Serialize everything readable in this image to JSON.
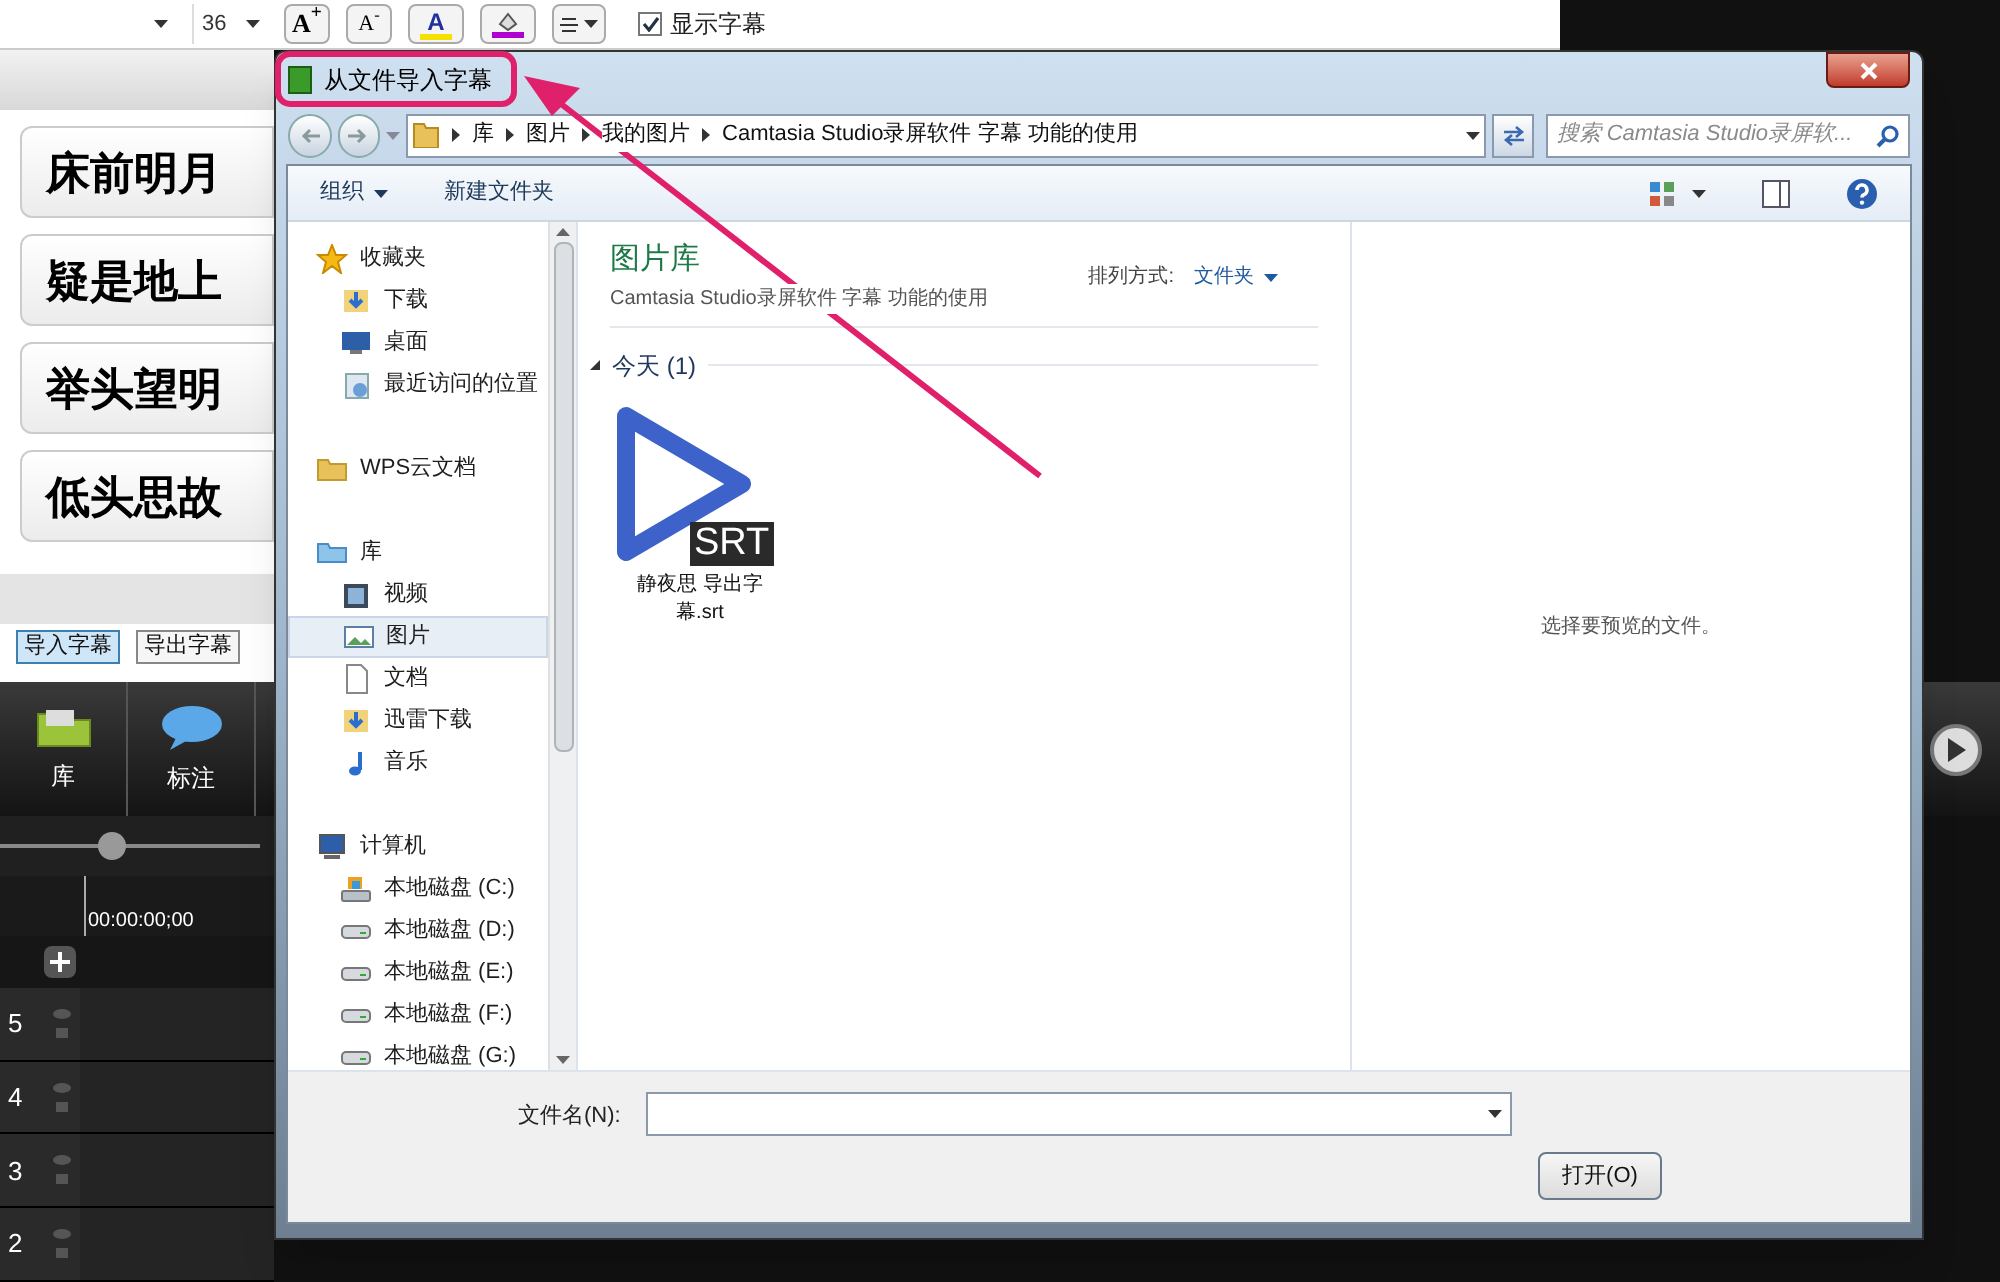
{
  "app": {
    "toolbar": {
      "font_size": "36",
      "grow_font": "A$^{+}$",
      "shrink_font": "A$^{-}$",
      "font_color": "A",
      "show_captions": {
        "label": "显示字幕",
        "checked": true
      }
    },
    "captions": [
      "床前明月",
      "疑是地上",
      "举头望明",
      "低头思故"
    ],
    "caption_buttons": [
      {
        "label": "导入字幕",
        "selected": true
      },
      {
        "label": "导出字幕",
        "selected": false
      }
    ],
    "tabs": [
      {
        "label": "库",
        "kind": "library"
      },
      {
        "label": "标注",
        "kind": "callout"
      }
    ],
    "zoom": {
      "level": 0.42
    },
    "timecode": "00:00:00;00",
    "tracks": [
      "5",
      "4",
      "3",
      "2"
    ]
  },
  "dialog": {
    "title": "从文件导入字幕",
    "breadcrumb": [
      "库",
      "图片",
      "我的图片",
      "Camtasia Studio录屏软件 字幕 功能的使用"
    ],
    "search": {
      "placeholder": "搜索 Camtasia Studio录屏软..."
    },
    "organize": "组织",
    "new_folder": "新建文件夹",
    "nav": [
      {
        "label": "收藏夹",
        "kind": "star",
        "selected": false,
        "children": [
          {
            "label": "下载",
            "kind": "download",
            "selected": false
          },
          {
            "label": "桌面",
            "kind": "desktop",
            "selected": false
          },
          {
            "label": "最近访问的位置",
            "kind": "recent",
            "selected": false
          }
        ]
      },
      {
        "label": "WPS云文档",
        "kind": "folder",
        "selected": false
      },
      {
        "label": "库",
        "kind": "library",
        "selected": false,
        "children": [
          {
            "label": "视频",
            "kind": "video",
            "selected": false
          },
          {
            "label": "图片",
            "kind": "picture",
            "selected": true
          },
          {
            "label": "文档",
            "kind": "document",
            "selected": false
          },
          {
            "label": "迅雷下载",
            "kind": "download",
            "selected": false
          },
          {
            "label": "音乐",
            "kind": "music",
            "selected": false
          }
        ]
      },
      {
        "label": "计算机",
        "kind": "computer",
        "selected": false,
        "children": [
          {
            "label": "本地磁盘 (C:)",
            "kind": "system-drive",
            "selected": false
          },
          {
            "label": "本地磁盘 (D:)",
            "kind": "drive",
            "selected": false
          },
          {
            "label": "本地磁盘 (E:)",
            "kind": "drive",
            "selected": false
          },
          {
            "label": "本地磁盘 (F:)",
            "kind": "drive",
            "selected": false
          },
          {
            "label": "本地磁盘 (G:)",
            "kind": "drive",
            "selected": false
          }
        ]
      }
    ],
    "library_title": "图片库",
    "library_subtitle": "Camtasia Studio录屏软件 字幕 功能的使用",
    "arrange_label": "排列方式:",
    "arrange_value": "文件夹",
    "group": {
      "label": "今天 (1)",
      "expanded": true
    },
    "files": [
      {
        "name": "静夜思 导出字幕.srt",
        "badge": "SRT"
      }
    ],
    "preview_hint": "选择要预览的文件。",
    "filename_label": "文件名(N):",
    "open_button": "打开(O)"
  }
}
